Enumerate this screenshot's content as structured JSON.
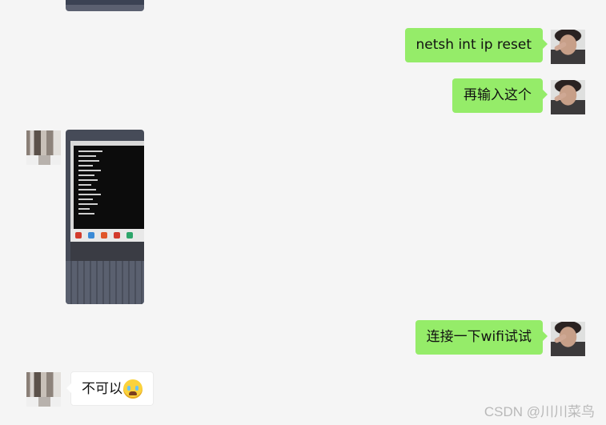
{
  "messages": [
    {
      "side": "out",
      "text": "netsh int ip reset"
    },
    {
      "side": "out",
      "text": "再输入这个"
    },
    {
      "side": "in",
      "type": "image"
    },
    {
      "side": "out",
      "text": "连接一下wifi试试"
    },
    {
      "side": "in",
      "text": "不可以",
      "emoji": "crying-face-emoji"
    }
  ],
  "watermark": "CSDN @川川菜鸟",
  "colors": {
    "background": "#f5f5f5",
    "outgoing_bubble": "#95ec69",
    "incoming_bubble": "#ffffff"
  }
}
